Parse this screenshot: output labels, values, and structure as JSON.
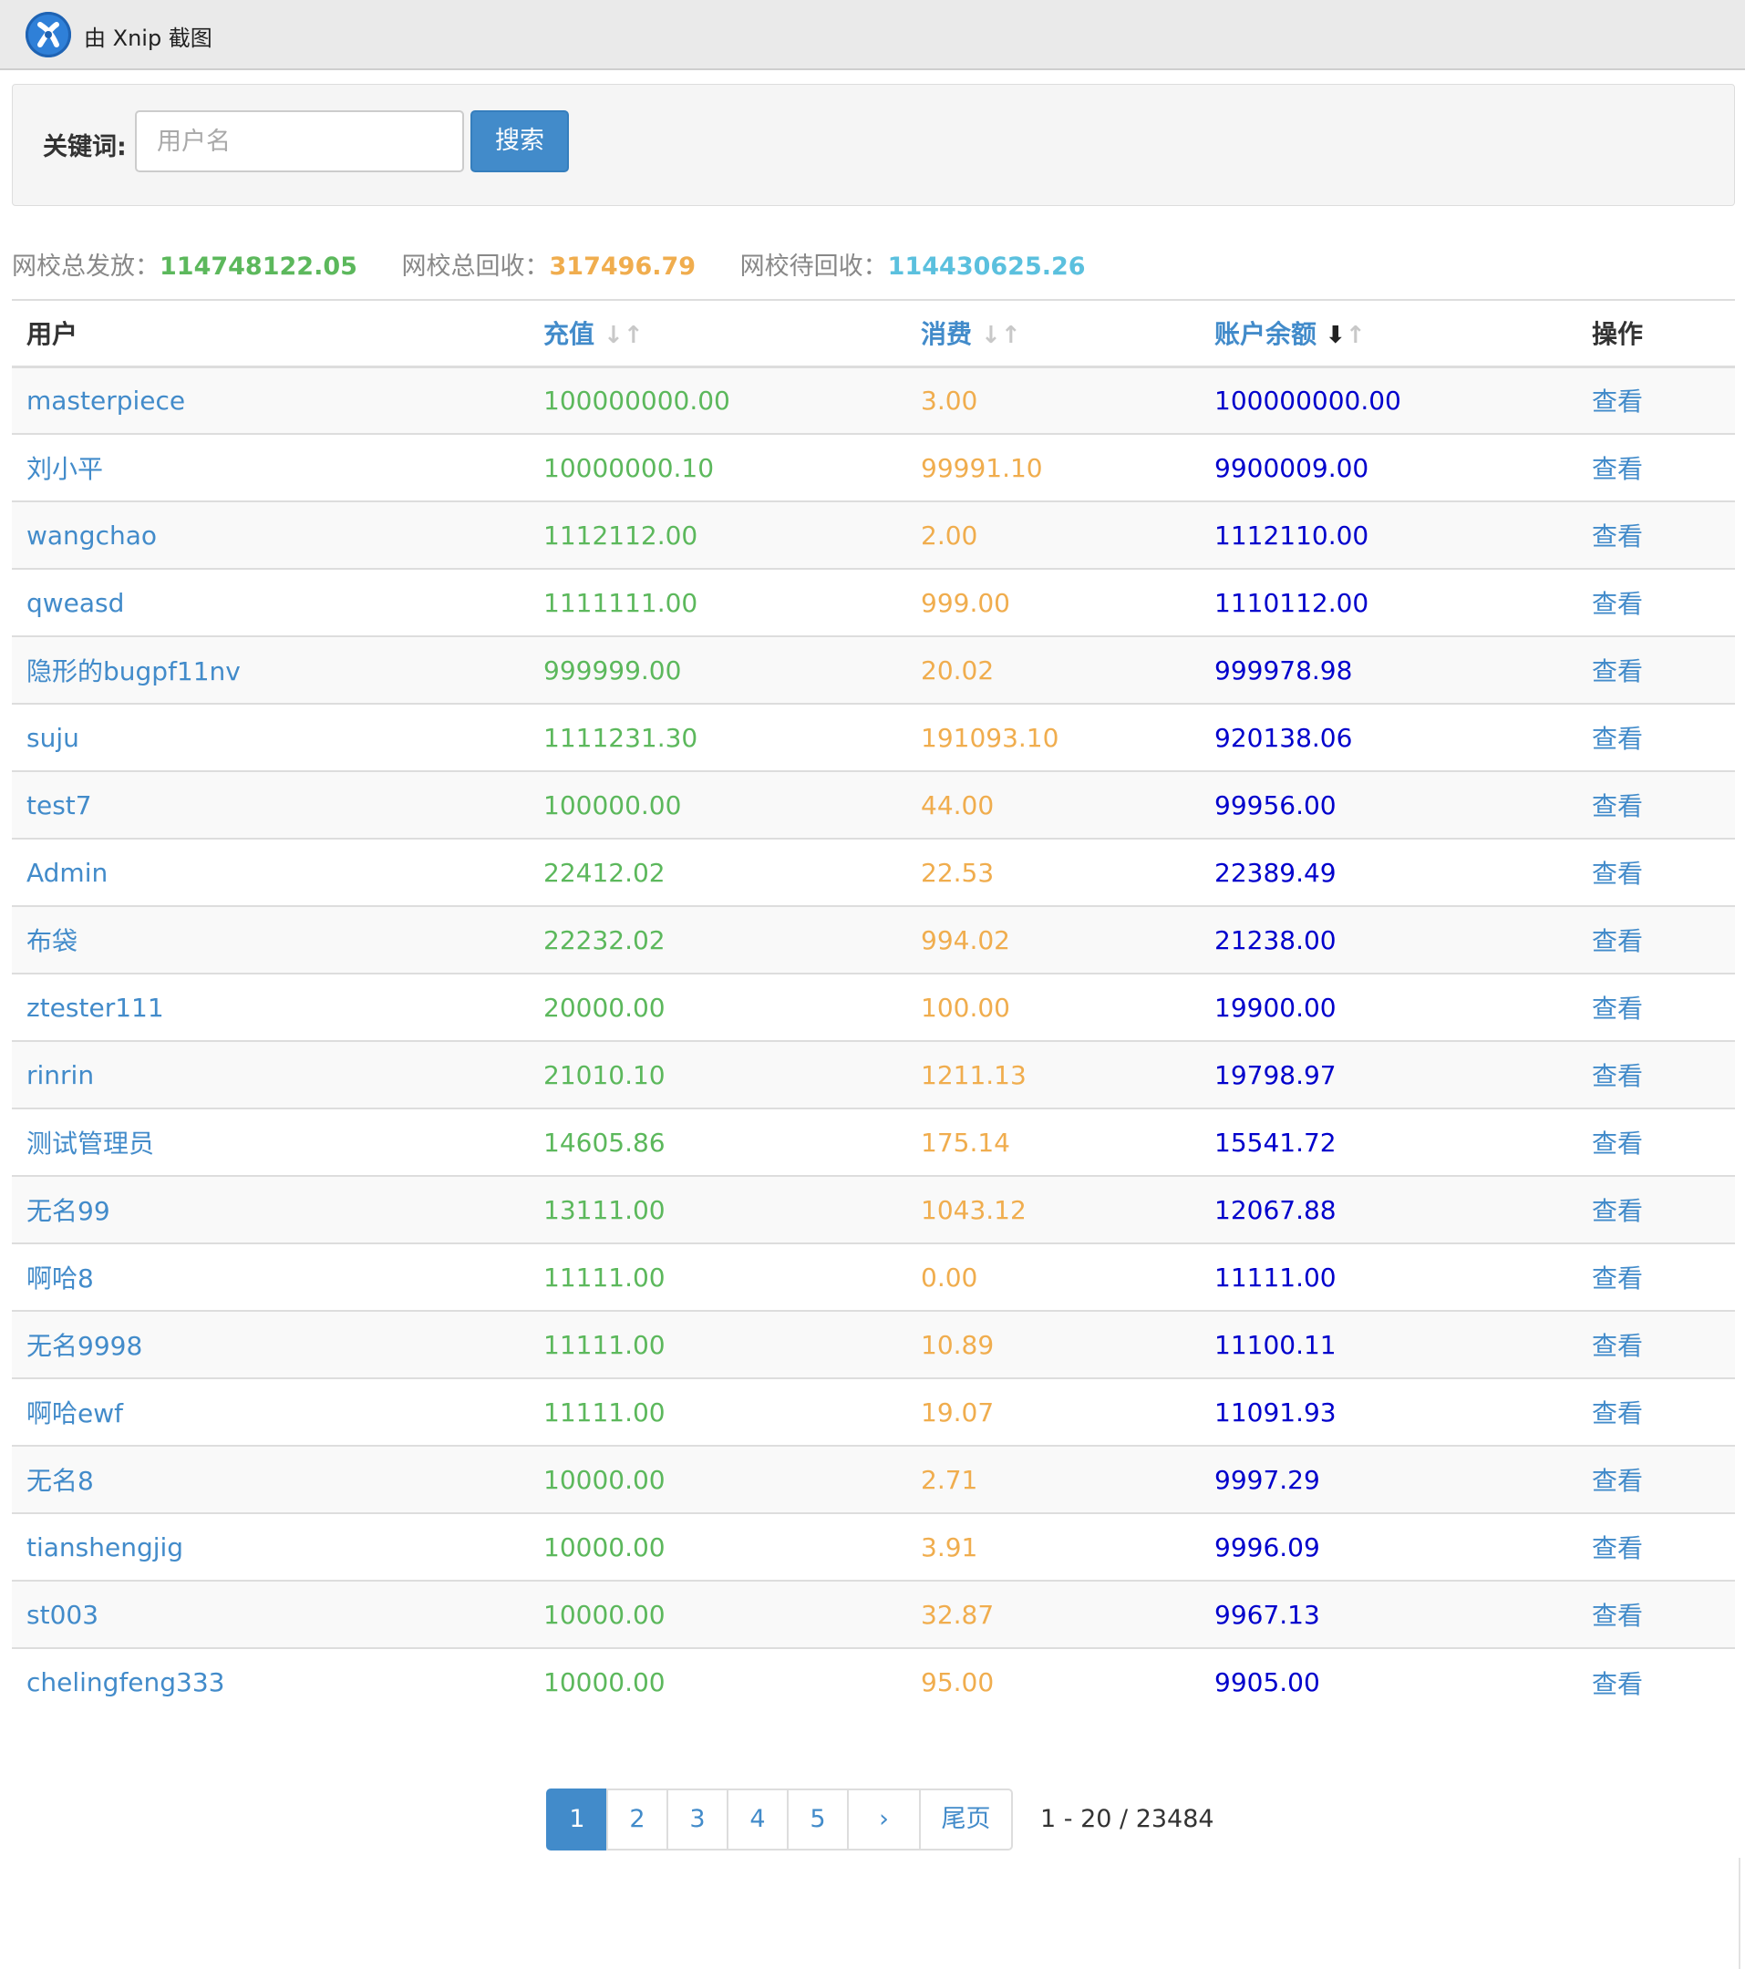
{
  "app": {
    "title": "由 Xnip 截图",
    "icon": "xnip-logo-icon"
  },
  "search": {
    "label": "关键词:",
    "placeholder": "用户名",
    "value": "",
    "button": "搜索"
  },
  "stats": {
    "issued_label": "网校总发放：",
    "issued_value": "114748122.05",
    "recovered_label": "网校总回收：",
    "recovered_value": "317496.79",
    "pending_label": "网校待回收：",
    "pending_value": "114430625.26"
  },
  "table": {
    "headers": {
      "user": "用户",
      "charge": "充值",
      "spend": "消费",
      "balance": "账户余额",
      "action": "操作"
    },
    "sort": {
      "column": "balance",
      "direction": "desc",
      "down_glyph": "↓",
      "up_glyph": "↑",
      "active_down_glyph": "🠗"
    },
    "rows": [
      {
        "user": "masterpiece",
        "charge": "100000000.00",
        "spend": "3.00",
        "balance": "100000000.00",
        "action": "查看"
      },
      {
        "user": "刘小平",
        "charge": "10000000.10",
        "spend": "99991.10",
        "balance": "9900009.00",
        "action": "查看"
      },
      {
        "user": "wangchao",
        "charge": "1112112.00",
        "spend": "2.00",
        "balance": "1112110.00",
        "action": "查看"
      },
      {
        "user": "qweasd",
        "charge": "1111111.00",
        "spend": "999.00",
        "balance": "1110112.00",
        "action": "查看"
      },
      {
        "user": "隐形的bugpf11nv",
        "charge": "999999.00",
        "spend": "20.02",
        "balance": "999978.98",
        "action": "查看"
      },
      {
        "user": "suju",
        "charge": "1111231.30",
        "spend": "191093.10",
        "balance": "920138.06",
        "action": "查看"
      },
      {
        "user": "test7",
        "charge": "100000.00",
        "spend": "44.00",
        "balance": "99956.00",
        "action": "查看"
      },
      {
        "user": "Admin",
        "charge": "22412.02",
        "spend": "22.53",
        "balance": "22389.49",
        "action": "查看"
      },
      {
        "user": "布袋",
        "charge": "22232.02",
        "spend": "994.02",
        "balance": "21238.00",
        "action": "查看"
      },
      {
        "user": "ztester111",
        "charge": "20000.00",
        "spend": "100.00",
        "balance": "19900.00",
        "action": "查看"
      },
      {
        "user": "rinrin",
        "charge": "21010.10",
        "spend": "1211.13",
        "balance": "19798.97",
        "action": "查看"
      },
      {
        "user": "测试管理员",
        "charge": "14605.86",
        "spend": "175.14",
        "balance": "15541.72",
        "action": "查看"
      },
      {
        "user": "无名99",
        "charge": "13111.00",
        "spend": "1043.12",
        "balance": "12067.88",
        "action": "查看"
      },
      {
        "user": "啊哈8",
        "charge": "11111.00",
        "spend": "0.00",
        "balance": "11111.00",
        "action": "查看"
      },
      {
        "user": "无名9998",
        "charge": "11111.00",
        "spend": "10.89",
        "balance": "11100.11",
        "action": "查看"
      },
      {
        "user": "啊哈ewf",
        "charge": "11111.00",
        "spend": "19.07",
        "balance": "11091.93",
        "action": "查看"
      },
      {
        "user": "无名8",
        "charge": "10000.00",
        "spend": "2.71",
        "balance": "9997.29",
        "action": "查看"
      },
      {
        "user": "tianshengjig",
        "charge": "10000.00",
        "spend": "3.91",
        "balance": "9996.09",
        "action": "查看"
      },
      {
        "user": "st003",
        "charge": "10000.00",
        "spend": "32.87",
        "balance": "9967.13",
        "action": "查看"
      },
      {
        "user": "chelingfeng333",
        "charge": "10000.00",
        "spend": "95.00",
        "balance": "9905.00",
        "action": "查看"
      }
    ]
  },
  "pagination": {
    "pages": [
      "1",
      "2",
      "3",
      "4",
      "5"
    ],
    "current": "1",
    "next": "›",
    "last": "尾页",
    "info": "1 - 20 / 23484"
  },
  "colors": {
    "link": "#428bca",
    "charge": "#5cb85c",
    "spend": "#f0ad4e",
    "balance": "#0000cc",
    "pending": "#5bc0de"
  }
}
